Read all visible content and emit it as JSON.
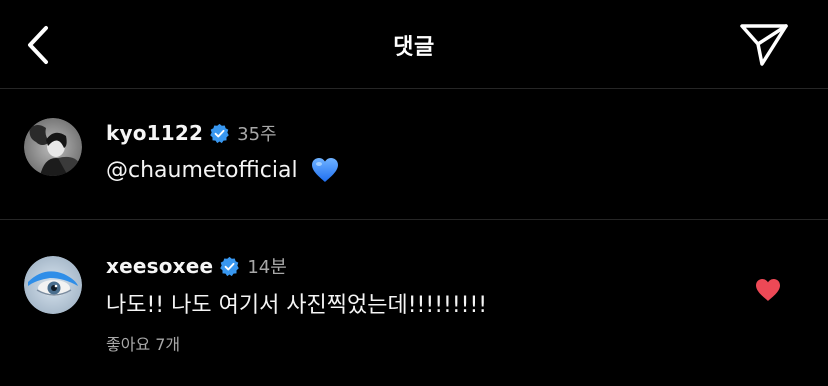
{
  "header": {
    "title": "댓글",
    "back_icon": "chevron-left-icon",
    "send_icon": "paper-plane-icon"
  },
  "comments": [
    {
      "username": "kyo1122",
      "verified": true,
      "time": "35주",
      "text": "@chaumetofficial",
      "emoji": "blue-heart-emoji"
    },
    {
      "username": "xeesoxee",
      "verified": true,
      "time": "14분",
      "text": "나도!! 나도 여기서 사진찍었는데!!!!!!!!!",
      "likes": "좋아요 7개",
      "liked": true,
      "like_icon": "heart-icon"
    }
  ],
  "colors": {
    "background": "#000000",
    "text": "#f5f5f5",
    "secondary_text": "#a8a8a8",
    "verified_blue": "#3897f0",
    "like_red": "#ed4956",
    "divider": "#262626"
  }
}
